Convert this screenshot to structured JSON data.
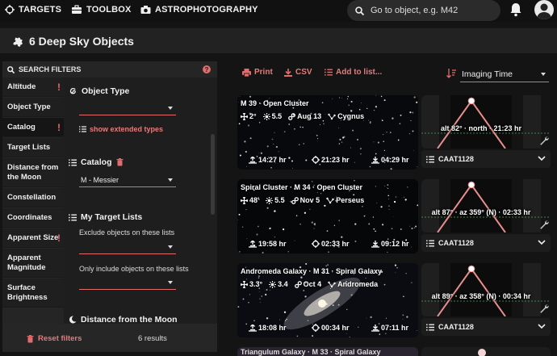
{
  "nav": {
    "targets": "TARGETS",
    "toolbox": "TOOLBOX",
    "astrophotography": "ASTROPHOTOGRAPHY",
    "search_placeholder": "Go to object, e.g. M42"
  },
  "title": "6 Deep Sky Objects",
  "filters": {
    "header": "SEARCH FILTERS",
    "nav_items": [
      {
        "label": "Altitude",
        "flag": "!"
      },
      {
        "label": "Object Type",
        "flag": ""
      },
      {
        "label": "Catalog",
        "flag": "!"
      },
      {
        "label": "Target Lists",
        "flag": ""
      },
      {
        "label": "Distance from the Moon",
        "flag": ""
      },
      {
        "label": "Constellation",
        "flag": ""
      },
      {
        "label": "Coordinates",
        "flag": ""
      },
      {
        "label": "Apparent Size",
        "flag": "!"
      },
      {
        "label": "Apparent Magnitude",
        "flag": ""
      },
      {
        "label": "Surface Brightness",
        "flag": ""
      }
    ],
    "object_type": {
      "title": "Object Type",
      "value": "",
      "link": "show extended types"
    },
    "catalog": {
      "title": "Catalog",
      "value": "M - Messier"
    },
    "target_lists": {
      "title": "My Target Lists",
      "exclude_label": "Exclude objects on these lists",
      "exclude_value": "",
      "include_label": "Only include objects on these lists",
      "include_value": ""
    },
    "moon": {
      "title": "Distance from the Moon"
    },
    "reset": "Reset filters",
    "results": "6 results"
  },
  "toolbar": {
    "print": "Print",
    "csv": "CSV",
    "add": "Add to list...",
    "sort": "Imaging Time"
  },
  "cards": [
    {
      "name": "M 39 · Open Cluster",
      "size": "2°",
      "mag": "5.5",
      "date": "Aug 13",
      "const": "Cygnus",
      "rise": "14:27 hr",
      "transit": "21:23 hr",
      "set": "04:29 hr",
      "alt": "alt 82° · north · 21:23 hr",
      "list": "CAAT1128"
    },
    {
      "name": "Spiral Cluster · M 34 · Open Cluster",
      "size": "48'",
      "mag": "5.5",
      "date": "Nov 5",
      "const": "Perseus",
      "rise": "19:58 hr",
      "transit": "02:33 hr",
      "set": "09:12 hr",
      "alt": "alt 87° · az 359° (N) · 02:33 hr",
      "list": "CAAT1128"
    },
    {
      "name": "Andromeda Galaxy · M 31 · Spiral Galaxy",
      "size": "3.3°",
      "mag": "3.4",
      "date": "Oct 4",
      "const": "Andromeda",
      "rise": "18:08 hr",
      "transit": "00:34 hr",
      "set": "07:11 hr",
      "alt": "alt 89° · az 358° (N) · 00:34 hr",
      "list": "CAAT1128"
    }
  ],
  "partial_card": {
    "name": "Triangulum Galaxy · M 33 · Spiral Galaxy"
  },
  "colors": {
    "accent": "#e06c6c",
    "background": "#141414",
    "panel": "#1e1e1e"
  }
}
